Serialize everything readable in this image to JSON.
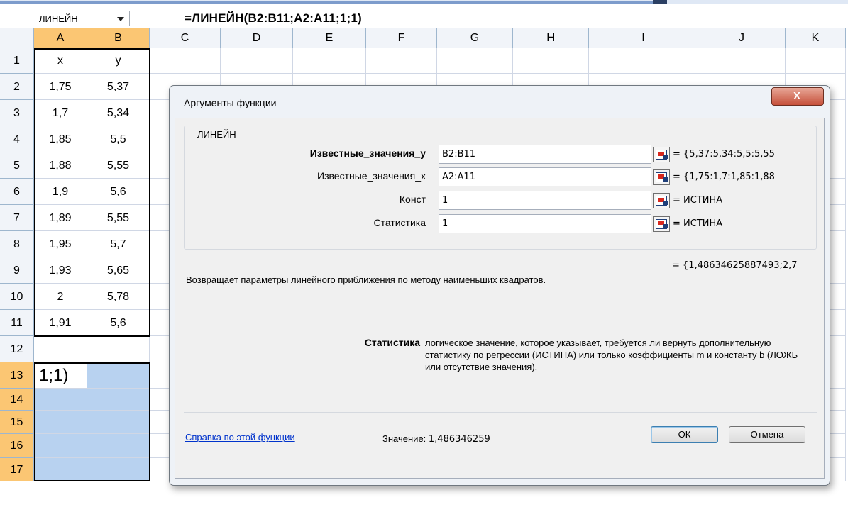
{
  "formula_bar": {
    "name_box": "ЛИНЕЙН",
    "formula": "=ЛИНЕЙН(B2:B11;A2:A11;1;1)"
  },
  "columns": [
    "A",
    "B",
    "C",
    "D",
    "E",
    "F",
    "G",
    "H",
    "I",
    "J",
    "K"
  ],
  "selected_columns": [
    "A",
    "B"
  ],
  "rows": [
    "1",
    "2",
    "3",
    "4",
    "5",
    "6",
    "7",
    "8",
    "9",
    "10",
    "11",
    "12",
    "13",
    "14",
    "15",
    "16",
    "17"
  ],
  "selected_rows": [
    "13",
    "14",
    "15",
    "16",
    "17"
  ],
  "table": {
    "header": [
      "x",
      "y"
    ],
    "data": [
      [
        "1,75",
        "5,37"
      ],
      [
        "1,7",
        "5,34"
      ],
      [
        "1,85",
        "5,5"
      ],
      [
        "1,88",
        "5,55"
      ],
      [
        "1,9",
        "5,6"
      ],
      [
        "1,89",
        "5,55"
      ],
      [
        "1,95",
        "5,7"
      ],
      [
        "1,93",
        "5,65"
      ],
      [
        "2",
        "5,78"
      ],
      [
        "1,91",
        "5,6"
      ]
    ]
  },
  "cell_a13": "1;1)",
  "dialog": {
    "title": "Аргументы функции",
    "close_label": "X",
    "function_name": "ЛИНЕЙН",
    "arguments": [
      {
        "label": "Известные_значения_y",
        "value": "B2:B11",
        "evaluated": "= {5,37:5,34:5,5:5,55"
      },
      {
        "label": "Известные_значения_x",
        "value": "A2:A11",
        "evaluated": "= {1,75:1,7:1,85:1,88"
      },
      {
        "label": "Конст",
        "value": "1",
        "evaluated": "= ИСТИНА"
      },
      {
        "label": "Статистика",
        "value": "1",
        "evaluated": "= ИСТИНА"
      }
    ],
    "result": "= {1,48634625887493;2,7",
    "description": "Возвращает параметры линейного приближения по методу наименьших квадратов.",
    "help_title": "Статистика",
    "help_text": "логическое значение, которое указывает, требуется ли вернуть дополнительную статистику по регрессии (ИСТИНА) или только коэффициенты m и константу b (ЛОЖЬ или отсутствие значения).",
    "help_link": "Справка по этой функции",
    "value_label": "Значение:",
    "value": "1,486346259",
    "ok_label": "ОК",
    "cancel_label": "Отмена"
  },
  "colors": {
    "header_bg": "#f1f4f9",
    "header_selected": "#fbc673",
    "cell_selected": "#b8d2f0",
    "gridline": "#d0d7e5",
    "link": "#0033cc"
  }
}
